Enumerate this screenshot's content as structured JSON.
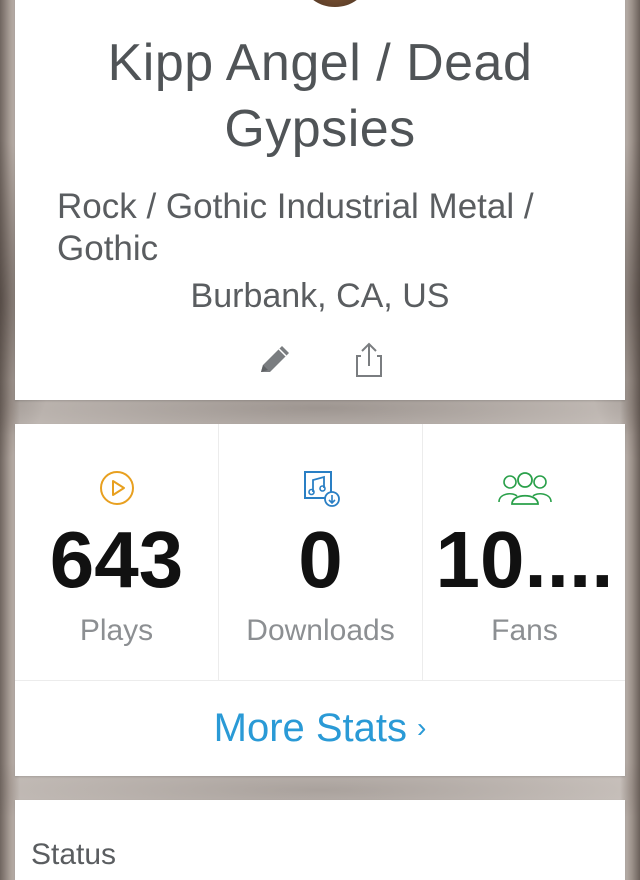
{
  "profile": {
    "artist_name": "Kipp Angel / Dead Gypsies",
    "genre": "Rock / Gothic Industrial Metal / Gothic",
    "location": "Burbank, CA, US",
    "actions": [
      {
        "icon": "pencil-icon"
      },
      {
        "icon": "share-icon"
      }
    ]
  },
  "stats": {
    "items": [
      {
        "icon": "play-circle-icon",
        "value": "643",
        "label": "Plays",
        "color": "#e8a020"
      },
      {
        "icon": "music-download-icon",
        "value": "0",
        "label": "Downloads",
        "color": "#2a7fc4"
      },
      {
        "icon": "fans-group-icon",
        "value": "10....",
        "label": "Fans",
        "color": "#2aa04a"
      }
    ],
    "more_label": "More Stats",
    "more_icon": "chevron-right-icon",
    "link_color": "#2a9ad6"
  },
  "status": {
    "title": "Status"
  }
}
